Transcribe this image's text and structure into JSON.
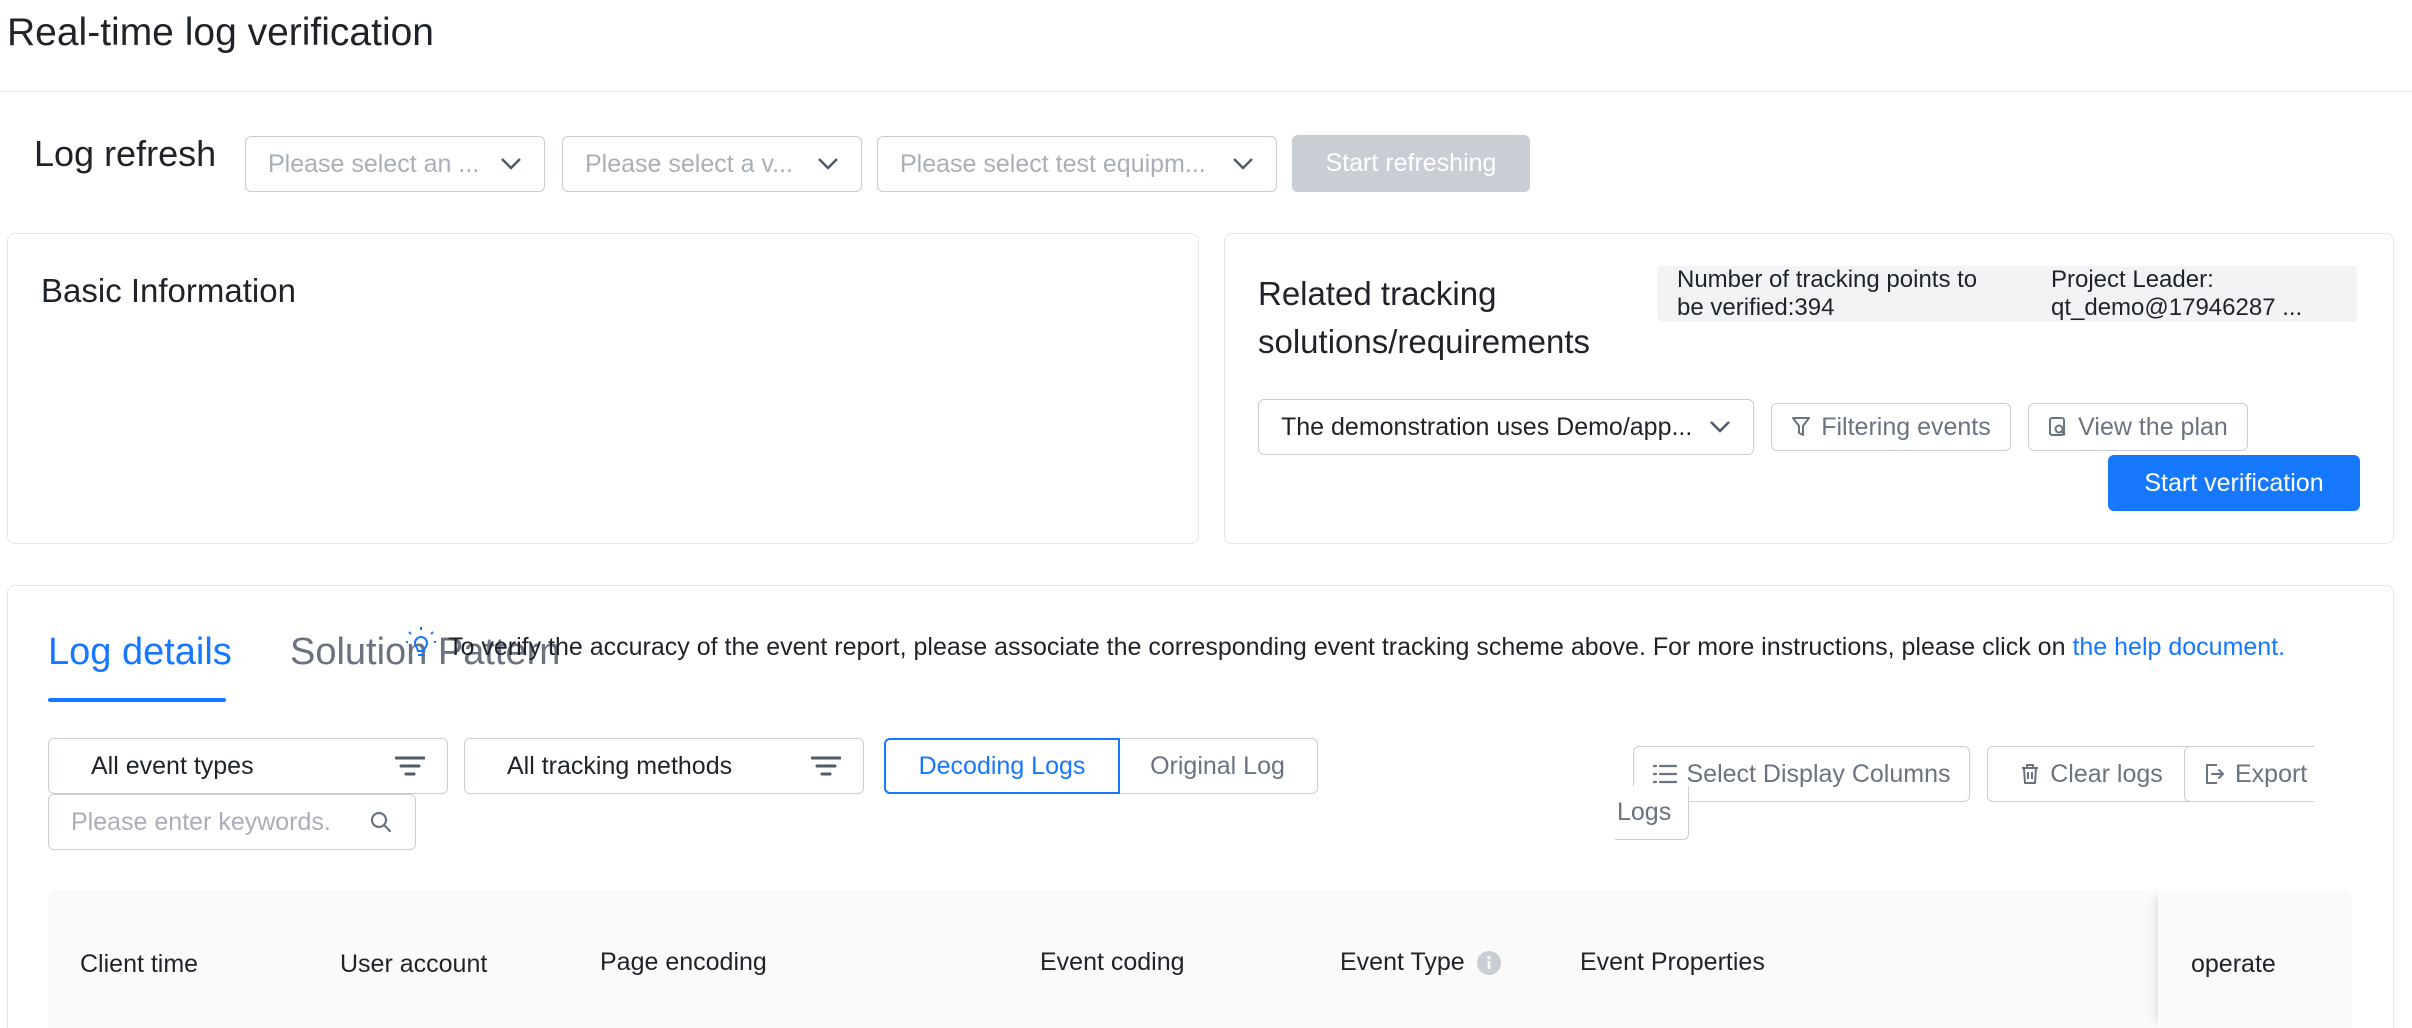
{
  "page": {
    "title": "Real-time log verification"
  },
  "log_refresh": {
    "label": "Log refresh",
    "app_select": {
      "placeholder": "Please select an ..."
    },
    "version_select": {
      "placeholder": "Please select a v..."
    },
    "device_select": {
      "placeholder": "Please select test equipm..."
    },
    "start_button": "Start refreshing"
  },
  "basic_info": {
    "title": "Basic Information"
  },
  "related": {
    "title_line1": "Related tracking",
    "title_line2": "solutions/requirements",
    "stats": {
      "count_line1": "Number of tracking points to",
      "count_line2": "be verified:394",
      "leader_line1": "Project Leader:",
      "leader_line2": "qt_demo@17946287 ..."
    },
    "plan_select": {
      "value": "The demonstration uses Demo/app..."
    },
    "filter_button": "Filtering events",
    "view_plan_button": "View the plan",
    "start_verification_button": "Start verification"
  },
  "log_details": {
    "tabs": [
      {
        "label": "Log details",
        "active": true
      },
      {
        "label": "Solution Pattern",
        "active": false
      }
    ],
    "hint": {
      "text": "To verify the accuracy of the event report, please associate the corresponding event tracking scheme above. For more instructions, please click on ",
      "link": "the help document."
    },
    "filters": {
      "event_types": "All event types",
      "tracking_methods": "All tracking methods",
      "segment": [
        "Decoding Logs",
        "Original Log"
      ],
      "active_segment": "Decoding Logs",
      "keyword_input": {
        "placeholder": "Please enter keywords."
      }
    },
    "actions": {
      "select_columns": "Select Display Columns",
      "clear_logs": "Clear logs",
      "export_line1": "Export",
      "export_line2": "Logs"
    },
    "table": {
      "columns": [
        "Client time",
        "User account",
        "Page encoding",
        "Event coding",
        "Event Type",
        "Event Properties",
        "operate"
      ]
    }
  },
  "colors": {
    "primary": "#1677ff",
    "disabled": "#c9cdd4",
    "border": "#e5e6eb",
    "text": "#1f2329",
    "placeholder": "#a9aeb8",
    "table_header_bg": "#fafafa"
  },
  "icons": [
    "chevron-down-icon",
    "funnel-icon",
    "plan-icon",
    "filter-lines-icon",
    "search-icon",
    "list-icon",
    "trash-icon",
    "export-icon",
    "info-icon",
    "lightbulb-icon"
  ]
}
